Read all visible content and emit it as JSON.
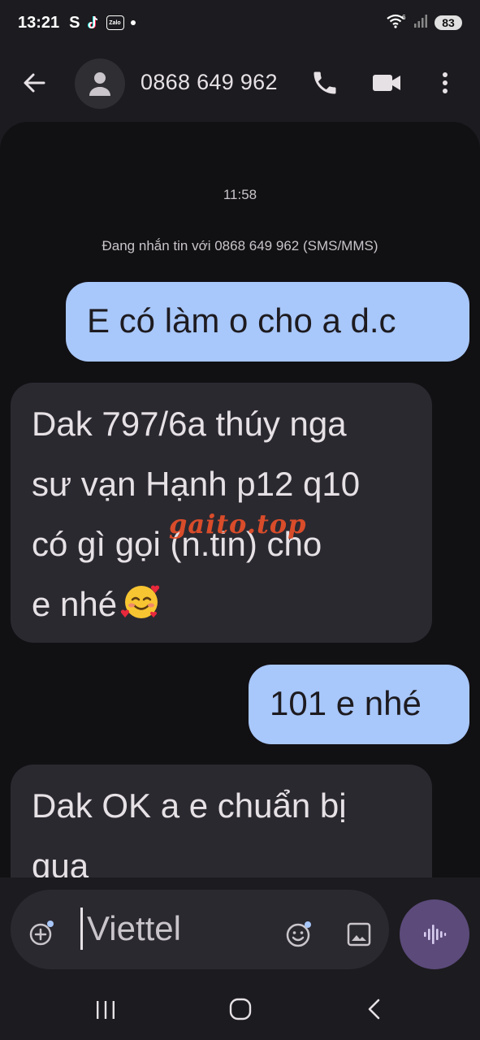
{
  "status_bar": {
    "time": "13:21",
    "s_label": "S",
    "zalo_label": "Zalo",
    "battery": "83",
    "signal_sub": "6"
  },
  "app_bar": {
    "contact": "0868 649 962"
  },
  "conversation": {
    "timestamp": "11:58",
    "info": "Đang nhắn tin với 0868 649 962 (SMS/MMS)",
    "messages": [
      {
        "direction": "outgoing",
        "text": "E có làm o cho a d.c"
      },
      {
        "direction": "incoming",
        "lines": [
          "Dak 797/6a thúy nga",
          "sư vạn Hạnh p12 q10",
          "có gì gọi (n.tin) cho",
          "e nhé"
        ],
        "emoji": "smiling-face-with-hearts"
      },
      {
        "direction": "outgoing",
        "text": "101 e nhé"
      },
      {
        "direction": "incoming",
        "lines": [
          "Dak OK a e chuẩn bị",
          "qua"
        ]
      }
    ],
    "watermark": "gaito.top"
  },
  "compose": {
    "placeholder": "Viettel"
  },
  "colors": {
    "background": "#1c1b1f",
    "panel": "#111013",
    "outgoing_bubble": "#a8c7fa",
    "incoming_bubble": "#2b2930",
    "voice_button": "#5b4a7a",
    "watermark": "#e8502a"
  }
}
